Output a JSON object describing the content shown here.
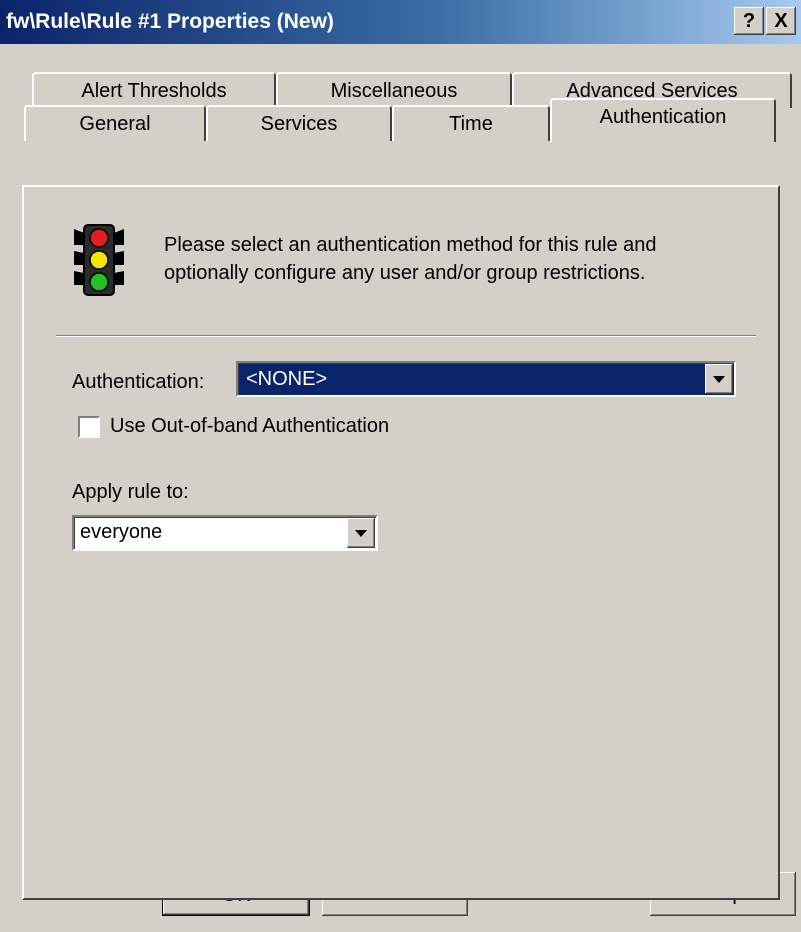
{
  "window": {
    "title": "fw\\Rule\\Rule #1 Properties (New)",
    "help_glyph": "?",
    "close_glyph": "X"
  },
  "tabs": {
    "row_back": [
      "Alert Thresholds",
      "Miscellaneous",
      "Advanced Services"
    ],
    "row_front": [
      "General",
      "Services",
      "Time",
      "Authentication"
    ],
    "active": "Authentication"
  },
  "info": {
    "icon": "traffic-light-icon",
    "line1": "Please select an authentication method for this rule and",
    "line2": "optionally configure any user and/or group restrictions."
  },
  "authentication": {
    "label": "Authentication:",
    "value": "<NONE>"
  },
  "out_of_band": {
    "label": "Use Out-of-band Authentication",
    "checked": false
  },
  "apply_rule": {
    "label": "Apply rule to:",
    "value": "everyone"
  },
  "buttons": {
    "ok": "OK",
    "cancel": "Cancel",
    "help": "Help"
  },
  "colors": {
    "title_start": "#0a246a",
    "title_end": "#a6caf0",
    "face": "#d4d0c8",
    "selection": "#0a246a"
  }
}
